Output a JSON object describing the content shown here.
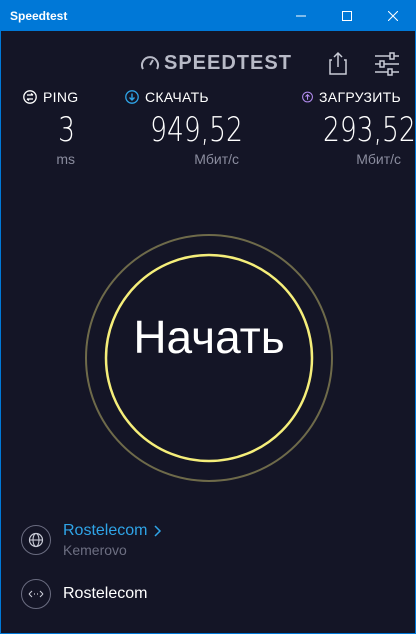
{
  "window": {
    "title": "Speedtest",
    "controls": [
      "minimize",
      "maximize",
      "close"
    ]
  },
  "header": {
    "logo_text": "SPEEDTEST",
    "logo_icon": "speedometer-icon",
    "share_icon": "share-icon",
    "settings_icon": "sliders-icon"
  },
  "metrics": {
    "ping": {
      "label": "PING",
      "value": "3",
      "unit": "ms",
      "color": "#ffffff"
    },
    "download": {
      "label": "СКАЧАТЬ",
      "value": "949,52",
      "unit": "Мбит/с",
      "color": "#2fa4e7"
    },
    "upload": {
      "label": "ЗАГРУЗИТЬ",
      "value": "293,52",
      "unit": "Мбит/с",
      "color": "#b38cf0"
    }
  },
  "start": {
    "label": "Начать",
    "ring_color": "#f5ee7a",
    "outer_ring_color": "#6e6a4a"
  },
  "server": {
    "isp": "Rostelecom",
    "city": "Kemerovo",
    "connection": "Rostelecom",
    "accent": "#2fa4e7"
  }
}
